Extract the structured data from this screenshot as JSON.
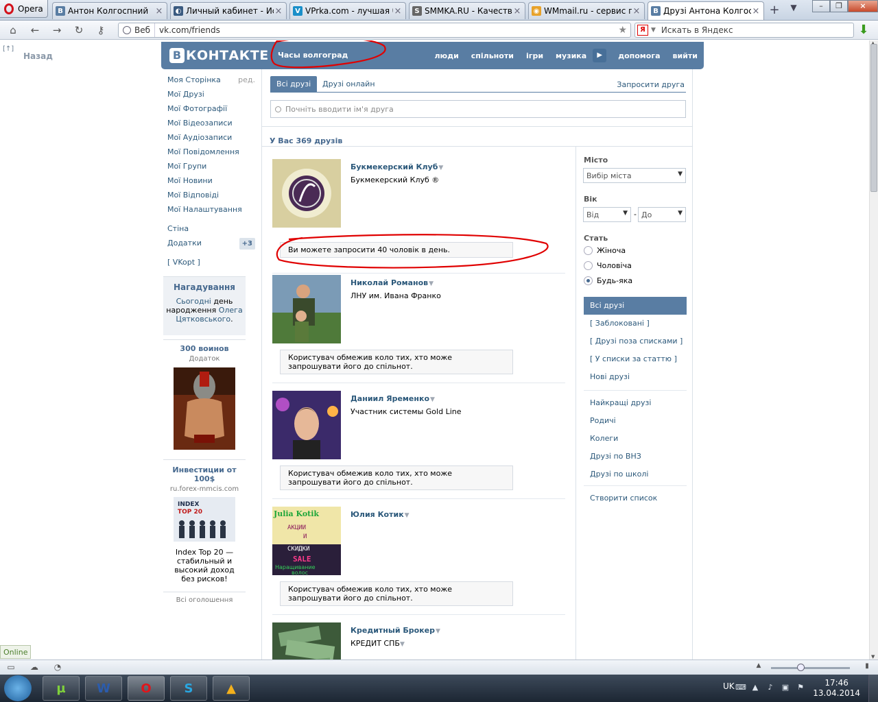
{
  "browser": {
    "menu_label": "Opera",
    "tabs": [
      {
        "title": "Антон Колгоспний",
        "icon": "vk-icon",
        "color": "#597da3",
        "glyph": "B"
      },
      {
        "title": "Личный кабинет - Ис...",
        "icon": "globe-icon",
        "color": "#3a5a80",
        "glyph": "◐"
      },
      {
        "title": "VPrka.com - лучшая б...",
        "icon": "vprka-icon",
        "color": "#1a8fc9",
        "glyph": "V"
      },
      {
        "title": "SMMKA.RU - Качестве...",
        "icon": "smmka-icon",
        "color": "#666666",
        "glyph": "S"
      },
      {
        "title": "WMmail.ru - сервис п...",
        "icon": "wmmail-icon",
        "color": "#e8a22a",
        "glyph": "◉"
      },
      {
        "title": "Друзі Антона Колгосп...",
        "icon": "vk-icon",
        "color": "#597da3",
        "glyph": "B"
      }
    ],
    "address_badge": "Веб",
    "url": "vk.com/friends",
    "search_placeholder": "Искать в Яндекс",
    "search_engine_glyph": "Я"
  },
  "page": {
    "back_label": "Назад",
    "back_arrow": "[↑]",
    "header": {
      "logo_letter": "B",
      "logo_word": "КОНТАКТЕ",
      "current": "Часы волгоград",
      "nav": [
        "люди",
        "спільноти",
        "ігри",
        "музика",
        "допомога",
        "вийти"
      ]
    },
    "left_menu": {
      "items": [
        "Моя Сторінка",
        "Мої Друзі",
        "Мої Фотографії",
        "Мої Відеозаписи",
        "Мої Аудіозаписи",
        "Мої Повідомлення",
        "Мої Групи",
        "Мої Новини",
        "Мої Відповіді",
        "Мої Налаштування"
      ],
      "edit_label": "ред.",
      "wall": "Стіна",
      "apps": "Додатки",
      "apps_badge": "+3",
      "vkopt": "[ VKopt ]"
    },
    "reminder": {
      "title": "Нагадування",
      "today": "Сьогодні",
      "text1": "день народження",
      "person": "Олега Цятковського",
      "dot": "."
    },
    "ads": [
      {
        "title": "300 воинов",
        "sub": "Додаток",
        "text": ""
      },
      {
        "title": "Инвестиции от 100$",
        "sub": "ru.forex-mmcis.com",
        "text": "Index Top 20 — стабильный и высокий доход без рисков!",
        "image_text_1": "INDEX",
        "image_text_2": "TOP 20"
      }
    ],
    "all_ads": "Всі оголошення",
    "tabs": [
      "Всі друзі",
      "Друзі онлайн"
    ],
    "invite": "Запросити друга",
    "search_placeholder": "Почніть вводити ім'я друга",
    "count_text": "У Вас 369 друзів",
    "friends": [
      {
        "name": "Букмекерский Клуб",
        "desc": "Букмекерский Клуб ®",
        "notice": "Ви можете запросити 40 чоловік в день."
      },
      {
        "name": "Николай Романов",
        "desc": "ЛНУ им. Ивана Франко",
        "notice": "Користувач обмежив коло тих, хто може запрошувати його до спільнот."
      },
      {
        "name": "Даниил Яременко",
        "desc": "Участник системы Gold Line",
        "notice": "Користувач обмежив коло тих, хто може запрошувати його до спільнот."
      },
      {
        "name": "Юлия Котик",
        "desc": "",
        "notice": "Користувач обмежив коло тих, хто може запрошувати його до спільнот.",
        "pic_text_1": "Julia Kotik",
        "pic_text_2": "АКЦИИ",
        "pic_text_3": "И",
        "pic_text_4": "СКИДКИ",
        "pic_text_5": "SALE",
        "pic_text_6": "Наращивание",
        "pic_text_7": "волос"
      },
      {
        "name": "Кредитный Брокер",
        "desc": "КРЕДИТ СПБ",
        "notice": ""
      }
    ],
    "filters": {
      "city_label": "Місто",
      "city_value": "Вибір міста",
      "age_label": "Вік",
      "age_from": "Від",
      "age_dash": "-",
      "age_to": "До",
      "sex_label": "Стать",
      "sex_options": [
        "Жіноча",
        "Чоловіча",
        "Будь-яка"
      ],
      "sex_selected": "Будь-яка",
      "lists": [
        "Всі друзі",
        "[ Заблоковані ]",
        "[ Друзі поза списками ]",
        "[ У списки за статтю ]",
        "Нові друзі"
      ],
      "lists2": [
        "Найкращі друзі",
        "Родичі",
        "Колеги",
        "Друзі по ВНЗ",
        "Друзі по школі"
      ],
      "create_list": "Створити список"
    }
  },
  "status": {
    "online_label": "Online"
  },
  "taskbar": {
    "lang": "UK",
    "time": "17:46",
    "date": "13.04.2014"
  },
  "colors": {
    "vk_blue": "#597da3",
    "link": "#2b587a",
    "annotation_red": "#e00000"
  }
}
